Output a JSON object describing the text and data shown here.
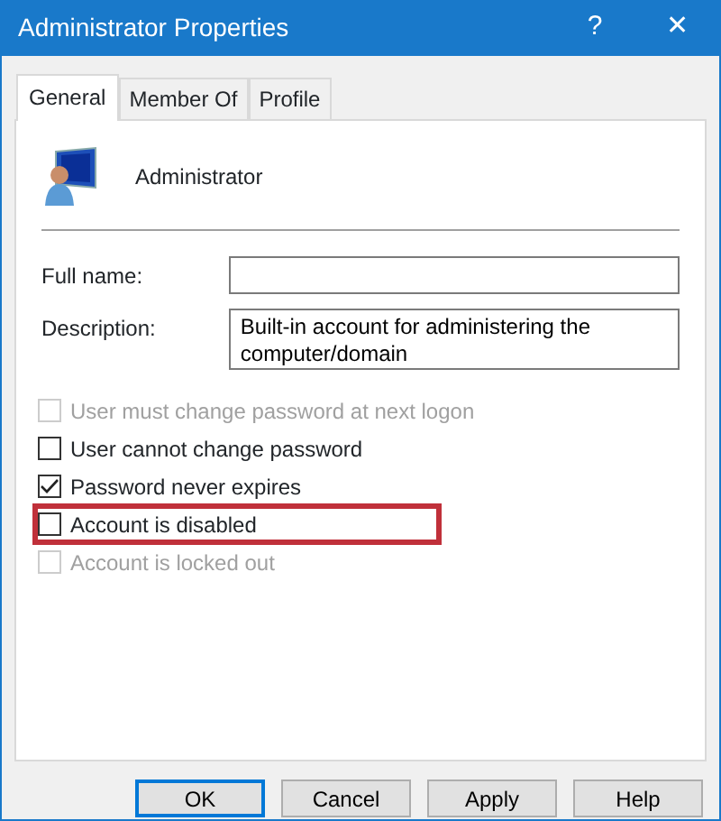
{
  "window": {
    "title": "Administrator Properties",
    "help": "?",
    "close": "✕"
  },
  "tabs": [
    {
      "label": "General",
      "selected": true
    },
    {
      "label": "Member Of",
      "selected": false
    },
    {
      "label": "Profile",
      "selected": false
    }
  ],
  "user": {
    "name": "Administrator"
  },
  "fields": [
    {
      "label": "Full name:",
      "kind": "line"
    },
    {
      "label": "Description:",
      "value": "Built-in account for administering the computer/domain",
      "kind": "multiline"
    }
  ],
  "checkboxes": [
    {
      "label": "User must change password at next logon",
      "checked": false,
      "disabled": true,
      "highlighted": false
    },
    {
      "label": "User cannot change password",
      "checked": false,
      "disabled": false,
      "highlighted": false
    },
    {
      "label": "Password never expires",
      "checked": true,
      "disabled": false,
      "highlighted": false
    },
    {
      "label": "Account is disabled",
      "checked": false,
      "disabled": false,
      "highlighted": true
    },
    {
      "label": "Account is locked out",
      "checked": false,
      "disabled": true,
      "highlighted": false
    }
  ],
  "buttons": [
    {
      "label": "OK",
      "default": true
    },
    {
      "label": "Cancel",
      "default": false
    },
    {
      "label": "Apply",
      "default": false
    },
    {
      "label": "Help",
      "default": false
    }
  ]
}
